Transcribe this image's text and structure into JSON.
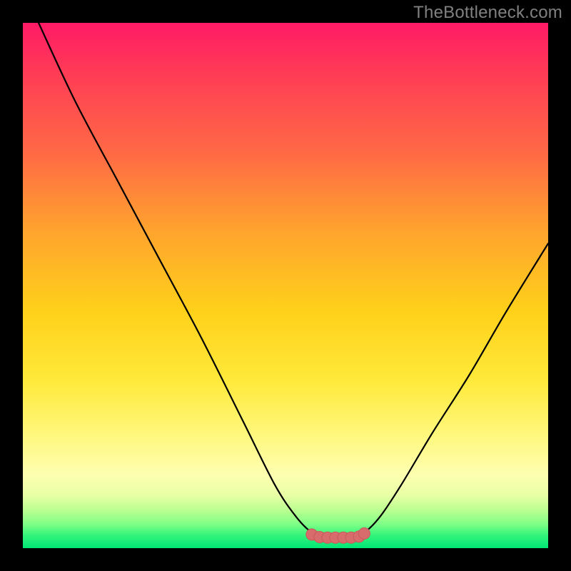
{
  "watermark": "TheBottleneck.com",
  "colors": {
    "frame_bg": "#000000",
    "gradient_top": "#ff1a66",
    "gradient_mid1": "#ffa52d",
    "gradient_mid2": "#ffe93a",
    "gradient_bottom": "#00e676",
    "curve": "#000000",
    "marker_fill": "#d86b6b",
    "marker_stroke": "#c85a5a"
  },
  "chart_data": {
    "type": "line",
    "title": "",
    "xlabel": "",
    "ylabel": "",
    "xlim": [
      0,
      100
    ],
    "ylim": [
      0,
      100
    ],
    "series": [
      {
        "name": "curve",
        "x": [
          3,
          10,
          18,
          26,
          34,
          42,
          48,
          52,
          55,
          58,
          62,
          65,
          68,
          72,
          78,
          85,
          92,
          100
        ],
        "y": [
          100,
          85,
          70,
          55,
          40,
          24,
          12,
          6,
          3,
          2,
          2,
          3,
          6,
          12,
          22,
          33,
          45,
          58
        ]
      }
    ],
    "flat_band": {
      "x_start": 55,
      "x_end": 65,
      "y": 2
    },
    "markers": {
      "x": [
        55,
        56.5,
        58,
        59.5,
        61,
        62.5,
        64,
        65
      ],
      "y": [
        2.6,
        2.1,
        2.0,
        2.0,
        2.0,
        2.0,
        2.2,
        2.8
      ]
    }
  }
}
